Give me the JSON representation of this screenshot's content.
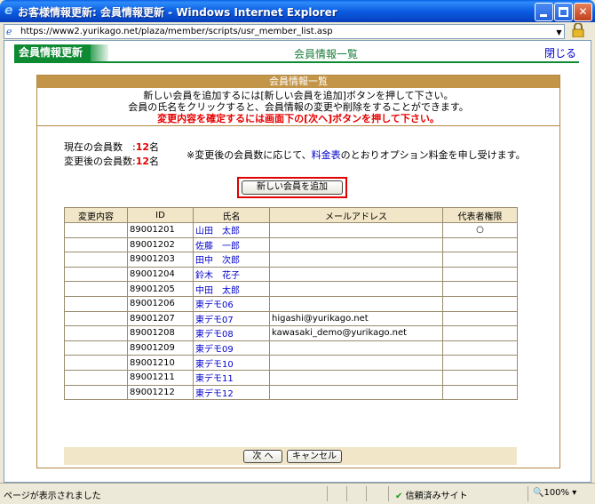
{
  "window": {
    "title": "お客様情報更新: 会員情報更新 - Windows Internet Explorer",
    "url": "https://www2.yurikago.net/plaza/member/scripts/usr_member_list.asp"
  },
  "nav": {
    "tab_label": "会員情報更新",
    "page_label": "会員情報一覧",
    "close_label": "閉じる"
  },
  "panel": {
    "heading": "会員情報一覧",
    "intro_line1": "新しい会員を追加するには[新しい会員を追加]ボタンを押して下さい。",
    "intro_line2": "会員の氏名をクリックすると、会員情報の変更や削除をすることができます。",
    "intro_line3": "変更内容を確定するには画面下の[次へ]ボタンを押して下さい。"
  },
  "counts": {
    "current_label": "現在の会員数",
    "current_value": "12",
    "after_label": "変更後の会員数",
    "after_value": "12",
    "unit": "名",
    "notice_before": "※変更後の会員数に応じて、",
    "notice_link": "料金表",
    "notice_after": "のとおりオプション料金を申し受けます。"
  },
  "add_button_label": "新しい会員を追加",
  "table": {
    "headers": [
      "変更内容",
      "ID",
      "氏名",
      "メールアドレス",
      "代表者権限"
    ],
    "rows": [
      {
        "change": "",
        "id": "89001201",
        "name": "山田　太郎",
        "email": "",
        "rep": "○"
      },
      {
        "change": "",
        "id": "89001202",
        "name": "佐藤　一郎",
        "email": "",
        "rep": ""
      },
      {
        "change": "",
        "id": "89001203",
        "name": "田中　次郎",
        "email": "",
        "rep": ""
      },
      {
        "change": "",
        "id": "89001204",
        "name": "鈴木　花子",
        "email": "",
        "rep": ""
      },
      {
        "change": "",
        "id": "89001205",
        "name": "中田　太郎",
        "email": "",
        "rep": ""
      },
      {
        "change": "",
        "id": "89001206",
        "name": "東デモ06",
        "email": "",
        "rep": ""
      },
      {
        "change": "",
        "id": "89001207",
        "name": "東デモ07",
        "email": "higashi@yurikago.net",
        "rep": ""
      },
      {
        "change": "",
        "id": "89001208",
        "name": "東デモ08",
        "email": "kawasaki_demo@yurikago.net",
        "rep": ""
      },
      {
        "change": "",
        "id": "89001209",
        "name": "東デモ09",
        "email": "",
        "rep": ""
      },
      {
        "change": "",
        "id": "89001210",
        "name": "東デモ10",
        "email": "",
        "rep": ""
      },
      {
        "change": "",
        "id": "89001211",
        "name": "東デモ11",
        "email": "",
        "rep": ""
      },
      {
        "change": "",
        "id": "89001212",
        "name": "東デモ12",
        "email": "",
        "rep": ""
      }
    ]
  },
  "footer": {
    "next_label": "次 へ",
    "cancel_label": "キャンセル"
  },
  "status": {
    "text": "ページが表示されました",
    "trust": "信頼済みサイト",
    "zoom": "100%"
  }
}
